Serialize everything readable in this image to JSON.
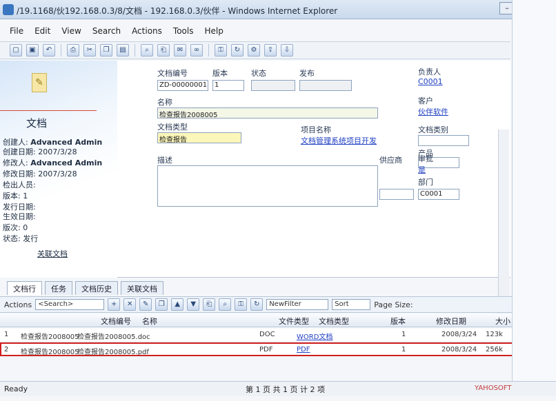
{
  "window": {
    "title": "/19.1168/伙192.168.0.3/8/文档 - 192.168.0.3/伙伴 - Windows Internet Explorer"
  },
  "menu": [
    "File",
    "Edit",
    "View",
    "Search",
    "Actions",
    "Tools",
    "Help"
  ],
  "toolbar_icons": [
    "new-icon",
    "save-icon",
    "undo-icon",
    "print-icon",
    "cut-icon",
    "copy-icon",
    "paste-icon",
    "find-icon",
    "attach-icon",
    "mail-icon",
    "link-icon",
    "lock-icon",
    "refresh-icon",
    "settings-icon",
    "export-icon",
    "import-icon"
  ],
  "left_panel": {
    "title": "文档",
    "rows": [
      {
        "label": "创建人:",
        "value": "Advanced Admin"
      },
      {
        "label": "创建日期:",
        "value": "2007/3/28"
      },
      {
        "label": "修改人:",
        "value": "Advanced Admin"
      },
      {
        "label": "修改日期:",
        "value": "2007/3/28"
      },
      {
        "label": "检出人员:",
        "value": ""
      },
      {
        "label": "版本:",
        "value": "1"
      },
      {
        "label": "发行日期:",
        "value": ""
      },
      {
        "label": "生效日期:",
        "value": ""
      },
      {
        "label": "版次:",
        "value": "0"
      },
      {
        "label": "状态:",
        "value": "发行"
      }
    ],
    "link": "关联文档"
  },
  "form": {
    "doc_number_label": "文档编号",
    "doc_number_value": "ZD-00000001",
    "version_label": "版本",
    "version_value": "1",
    "status_label": "状态",
    "status_value": "",
    "modified_label": "发布",
    "modified_value": "",
    "owner_label": "负责人",
    "owner_value": "C0001",
    "name_label": "名称",
    "name_value": "检查报告2008005",
    "type_label": "文档类型",
    "type_value": "检查报告",
    "project_label": "项目名称",
    "project_value": "文档管理系统项目开发",
    "customer_label": "客户",
    "customer_value": "伙伴软件",
    "doc_class_label": "文档类别",
    "doc_class_value": "",
    "desc_label": "描述",
    "product_label": "产品",
    "product_value": "",
    "vendor_label": "供应商",
    "vendor_value": "",
    "review_label": "审批",
    "review_value": "是",
    "dept_label": "部门",
    "dept_value": "C0001"
  },
  "tabs": [
    "文档行",
    "任务",
    "文档历史",
    "关联文档"
  ],
  "gridbar": {
    "actions": "Actions",
    "search_placeholder": "<Search>",
    "filter": "NewFilter",
    "sort": "Sort",
    "page_size": "Page Size:"
  },
  "grid": {
    "headers": [
      "文档编号",
      "名称",
      "文件类型",
      "文档类型",
      "版本",
      "修改日期",
      "大小"
    ],
    "rows": [
      {
        "no": "1",
        "doc": "检查报告2008005",
        "name": "检查报告2008005.doc",
        "ftype": "DOC",
        "dtype": "WORD文档",
        "ver": "1",
        "date": "2008/3/24",
        "size": "123k"
      },
      {
        "no": "2",
        "doc": "检查报告2008005",
        "name": "检查报告2008005.pdf",
        "ftype": "PDF",
        "dtype": "PDF",
        "ver": "1",
        "date": "2008/3/24",
        "size": "256k"
      }
    ]
  },
  "status": {
    "left": "Ready",
    "mid": "第 1 页 共 1 页   计 2 项",
    "watermark": "YAHOSOFT"
  }
}
